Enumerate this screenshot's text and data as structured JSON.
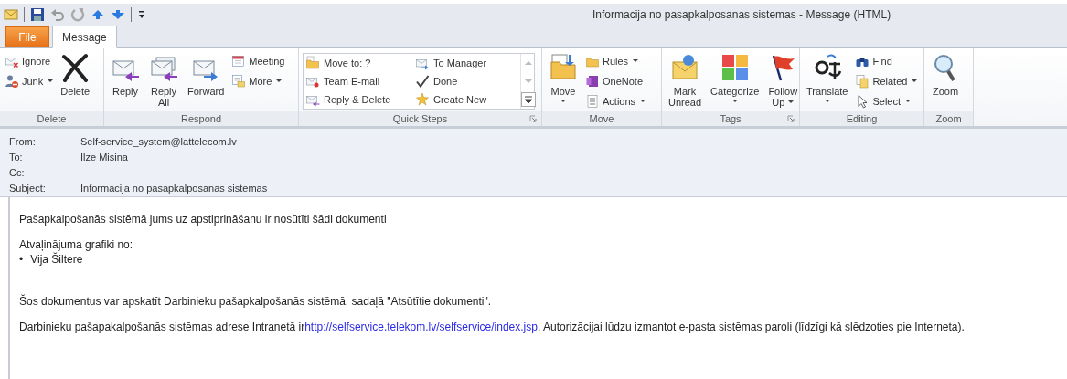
{
  "window": {
    "title": "Informacija no pasapkalposanas sistemas  -  Message (HTML)"
  },
  "tabs": [
    {
      "label": "File",
      "kind": "file",
      "selected": false
    },
    {
      "label": "Message",
      "kind": "tab",
      "selected": true
    }
  ],
  "ribbon": {
    "groups": [
      {
        "label": "Delete",
        "kind": "buttons",
        "launcher": false,
        "columns": [
          [
            {
              "kind": "small",
              "label": "Ignore",
              "dropdown": false
            },
            {
              "kind": "small",
              "label": "Junk",
              "dropdown": true
            }
          ],
          [
            {
              "kind": "large",
              "lines": [
                "Delete"
              ],
              "dropdown": false
            }
          ]
        ]
      },
      {
        "label": "Respond",
        "kind": "buttons",
        "launcher": false,
        "columns": [
          [
            {
              "kind": "large",
              "lines": [
                "Reply"
              ],
              "dropdown": false
            }
          ],
          [
            {
              "kind": "large",
              "lines": [
                "Reply",
                "All"
              ],
              "dropdown": false
            }
          ],
          [
            {
              "kind": "large",
              "lines": [
                "Forward"
              ],
              "dropdown": false
            }
          ],
          [
            {
              "kind": "small",
              "label": "Meeting",
              "dropdown": false
            },
            {
              "kind": "small",
              "label": "More",
              "dropdown": true
            }
          ]
        ]
      },
      {
        "label": "Quick Steps",
        "kind": "gallery",
        "launcher": true,
        "items": [
          {
            "label": "Move to: ?"
          },
          {
            "label": "To Manager"
          },
          {
            "label": "Team E-mail"
          },
          {
            "label": "Done"
          },
          {
            "label": "Reply & Delete"
          },
          {
            "label": "Create New"
          }
        ]
      },
      {
        "label": "Move",
        "kind": "buttons",
        "launcher": false,
        "columns": [
          [
            {
              "kind": "large",
              "lines": [
                "Move"
              ],
              "dropdown": true
            }
          ],
          [
            {
              "kind": "small",
              "label": "Rules",
              "dropdown": true
            },
            {
              "kind": "small",
              "label": "OneNote",
              "dropdown": false
            },
            {
              "kind": "small",
              "label": "Actions",
              "dropdown": true
            }
          ]
        ]
      },
      {
        "label": "Tags",
        "kind": "buttons",
        "launcher": true,
        "columns": [
          [
            {
              "kind": "large",
              "lines": [
                "Mark",
                "Unread"
              ],
              "dropdown": false
            }
          ],
          [
            {
              "kind": "large",
              "lines": [
                "Categorize"
              ],
              "dropdown": true
            }
          ],
          [
            {
              "kind": "large",
              "lines": [
                "Follow",
                "Up"
              ],
              "dropdown": true
            }
          ]
        ]
      },
      {
        "label": "Editing",
        "kind": "buttons",
        "launcher": false,
        "columns": [
          [
            {
              "kind": "large",
              "lines": [
                "Translate"
              ],
              "dropdown": true
            }
          ],
          [
            {
              "kind": "small",
              "label": "Find",
              "dropdown": false
            },
            {
              "kind": "small",
              "label": "Related",
              "dropdown": true
            },
            {
              "kind": "small",
              "label": "Select",
              "dropdown": true
            }
          ]
        ]
      },
      {
        "label": "Zoom",
        "kind": "buttons",
        "launcher": false,
        "columns": [
          [
            {
              "kind": "large",
              "lines": [
                "Zoom"
              ],
              "dropdown": false
            }
          ]
        ]
      }
    ]
  },
  "header": {
    "fields": [
      {
        "label": "From:",
        "value": "Self-service_system@lattelecom.lv"
      },
      {
        "label": "To:",
        "value": "Ilze Misina"
      },
      {
        "label": "Cc:"
      },
      {
        "label": "Subject:",
        "value": "Informacija no pasapkalposanas sistemas"
      }
    ]
  },
  "body": {
    "blocks": [
      {
        "kind": "text",
        "text": "Pašapkalpošanās sistēmā jums uz apstiprināšanu ir nosūtīti šādi dokumenti"
      },
      {
        "kind": "text",
        "text": "Atvaļinājuma grafiki no:"
      },
      {
        "kind": "list",
        "items": [
          {
            "bullet": "•",
            "text": "Vija Šiltere"
          }
        ]
      },
      {
        "kind": "text",
        "text": "Šos dokumentus var apskatīt Darbinieku pašapkalpošanās sistēmā, sadaļā \"Atsūtītie dokumenti\"."
      },
      {
        "kind": "link_text",
        "before": "Darbinieku pašapakalpošanās sistēmas adrese Intranetā ir",
        "link": "http://selfservice.telekom.lv/selfservice/index.jsp",
        "after": ". Autorizācijai lūdzu izmantot e-pasta sistēmas paroli (līdzīgi kā slēdzoties pie Interneta)."
      }
    ]
  }
}
